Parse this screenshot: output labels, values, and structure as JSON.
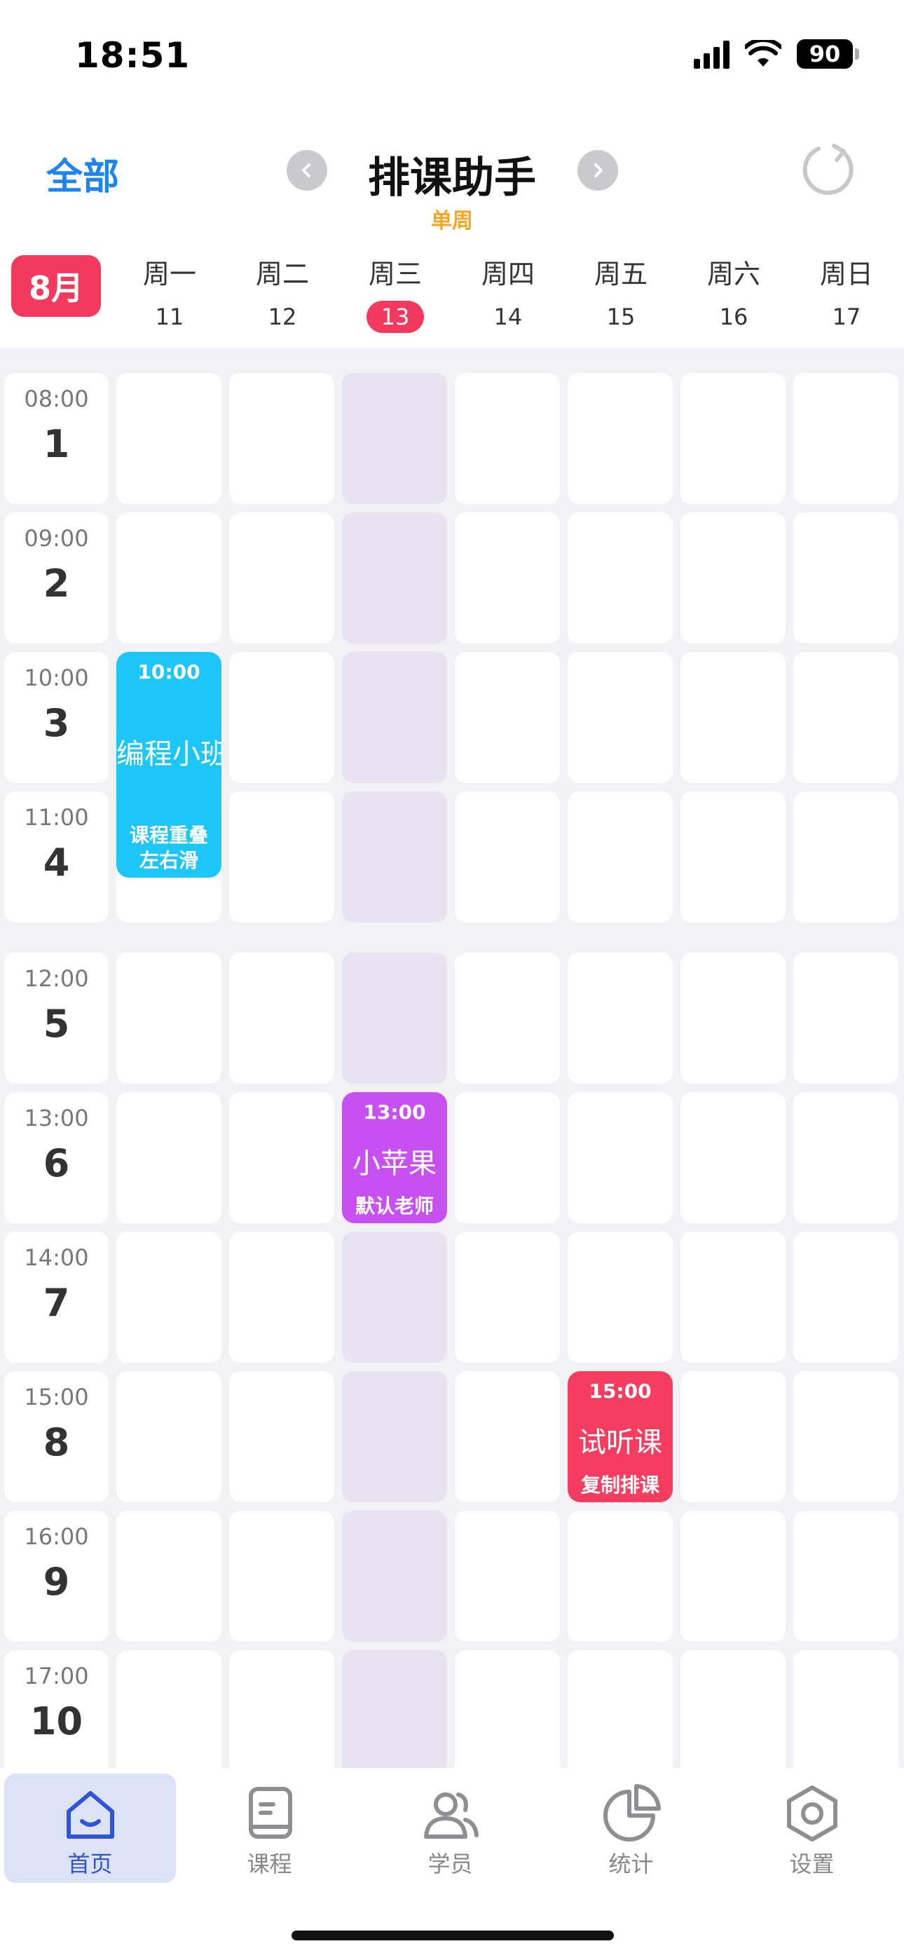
{
  "status": {
    "time": "18:51",
    "battery": "90"
  },
  "header": {
    "all_label": "全部",
    "title": "排课助手",
    "week_mode": "单周",
    "month": "8月"
  },
  "days": [
    {
      "name": "周一",
      "num": "11"
    },
    {
      "name": "周二",
      "num": "12"
    },
    {
      "name": "周三",
      "num": "13",
      "today": true
    },
    {
      "name": "周四",
      "num": "14"
    },
    {
      "name": "周五",
      "num": "15"
    },
    {
      "name": "周六",
      "num": "16"
    },
    {
      "name": "周日",
      "num": "17"
    }
  ],
  "periods": [
    {
      "start": "08:00",
      "num": "1"
    },
    {
      "start": "09:00",
      "num": "2"
    },
    {
      "start": "10:00",
      "num": "3"
    },
    {
      "start": "11:00",
      "num": "4"
    },
    {
      "start": "12:00",
      "num": "5"
    },
    {
      "start": "13:00",
      "num": "6"
    },
    {
      "start": "14:00",
      "num": "7"
    },
    {
      "start": "15:00",
      "num": "8"
    },
    {
      "start": "16:00",
      "num": "9"
    },
    {
      "start": "17:00",
      "num": "10"
    }
  ],
  "events": [
    {
      "day": 0,
      "period": 3,
      "span": 2,
      "time": "10:00",
      "title": "编程小班",
      "note_lines": [
        "课程重叠",
        "左右滑"
      ],
      "color": "#1ec6f8"
    },
    {
      "day": 2,
      "period": 6,
      "span": 1,
      "time": "13:00",
      "title": "小苹果",
      "note_lines": [
        "默认老师"
      ],
      "color": "#c84ff0"
    },
    {
      "day": 4,
      "period": 8,
      "span": 1,
      "time": "15:00",
      "title": "试听课",
      "note_lines": [
        "复制排课"
      ],
      "color": "#f53d5f"
    }
  ],
  "tabs": [
    {
      "label": "首页",
      "icon": "home-icon",
      "active": true
    },
    {
      "label": "课程",
      "icon": "book-icon"
    },
    {
      "label": "学员",
      "icon": "users-icon"
    },
    {
      "label": "统计",
      "icon": "pie-chart-icon"
    },
    {
      "label": "设置",
      "icon": "settings-icon"
    }
  ],
  "colors": {
    "accent": "#1e84f0",
    "today": "#f13a5e",
    "week_mode": "#f5a623",
    "today_column": "#e9e2f1",
    "tab_active": "#2f55d4"
  }
}
